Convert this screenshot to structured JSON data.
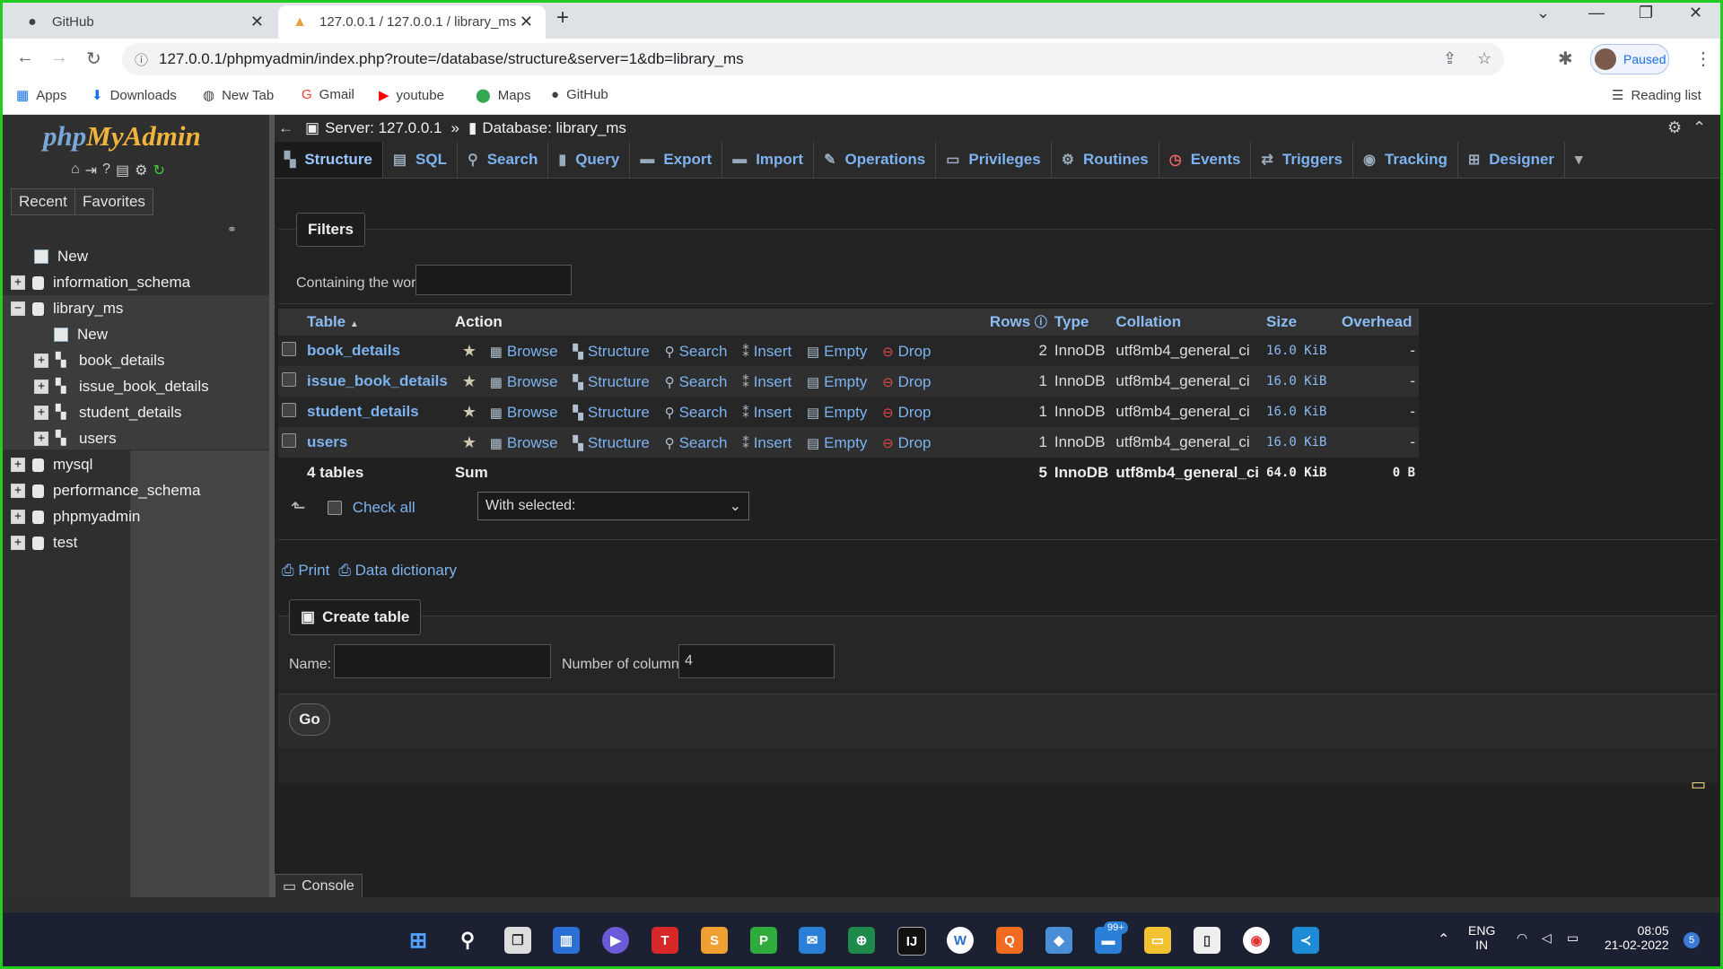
{
  "browser": {
    "tabs": [
      {
        "title": "GitHub",
        "icon": "github-icon"
      },
      {
        "title": "127.0.0.1 / 127.0.0.1 / library_ms",
        "icon": "phpmyadmin-icon"
      }
    ],
    "url": "127.0.0.1/phpmyadmin/index.php?route=/database/structure&server=1&db=library_ms",
    "profile_status": "Paused",
    "bookmarks": [
      "Apps",
      "Downloads",
      "New Tab",
      "Gmail",
      "youtube",
      "Maps",
      "GitHub"
    ],
    "reading_list": "Reading list"
  },
  "pma": {
    "logo_php": "php",
    "logo_myadmin": "MyAdmin",
    "sidebar": {
      "recent": "Recent",
      "favorites": "Favorites",
      "tree": [
        {
          "label": "New",
          "level": 0
        },
        {
          "label": "information_schema",
          "level": 0
        },
        {
          "label": "library_ms",
          "level": 0
        },
        {
          "label": "New",
          "level": 1
        },
        {
          "label": "book_details",
          "level": 1
        },
        {
          "label": "issue_book_details",
          "level": 1
        },
        {
          "label": "student_details",
          "level": 1
        },
        {
          "label": "users",
          "level": 1
        },
        {
          "label": "mysql",
          "level": 0
        },
        {
          "label": "performance_schema",
          "level": 0
        },
        {
          "label": "phpmyadmin",
          "level": 0
        },
        {
          "label": "test",
          "level": 0
        }
      ]
    },
    "breadcrumb": {
      "server": "Server: 127.0.0.1",
      "separator": "»",
      "database": "Database: library_ms"
    },
    "tabs": [
      "Structure",
      "SQL",
      "Search",
      "Query",
      "Export",
      "Import",
      "Operations",
      "Privileges",
      "Routines",
      "Events",
      "Triggers",
      "Tracking",
      "Designer"
    ],
    "filters": {
      "legend": "Filters",
      "label": "Containing the word:",
      "value": ""
    },
    "table_headers": {
      "table": "Table",
      "sort": "▲",
      "action": "Action",
      "rows": "Rows",
      "type": "Type",
      "collation": "Collation",
      "size": "Size",
      "overhead": "Overhead"
    },
    "actions": {
      "browse": "Browse",
      "structure": "Structure",
      "search": "Search",
      "insert": "Insert",
      "empty": "Empty",
      "drop": "Drop"
    },
    "rows": [
      {
        "name": "book_details",
        "rows": "2",
        "type": "InnoDB",
        "collation": "utf8mb4_general_ci",
        "size": "16.0 KiB",
        "overhead": "-"
      },
      {
        "name": "issue_book_details",
        "rows": "1",
        "type": "InnoDB",
        "collation": "utf8mb4_general_ci",
        "size": "16.0 KiB",
        "overhead": "-"
      },
      {
        "name": "student_details",
        "rows": "1",
        "type": "InnoDB",
        "collation": "utf8mb4_general_ci",
        "size": "16.0 KiB",
        "overhead": "-"
      },
      {
        "name": "users",
        "rows": "1",
        "type": "InnoDB",
        "collation": "utf8mb4_general_ci",
        "size": "16.0 KiB",
        "overhead": "-"
      }
    ],
    "summary": {
      "name": "4 tables",
      "action": "Sum",
      "rows": "5",
      "type": "InnoDB",
      "collation": "utf8mb4_general_ci",
      "size": "64.0 KiB",
      "overhead": "0 B"
    },
    "check_all": "Check all",
    "with_selected": "With selected:",
    "print": "Print",
    "data_dictionary": "Data dictionary",
    "create_table": {
      "legend": "Create table",
      "name_label": "Name:",
      "name_value": "",
      "columns_label": "Number of columns:",
      "columns_value": "4",
      "go": "Go"
    },
    "console": "Console"
  },
  "taskbar": {
    "badge": "99+",
    "lang_line1": "ENG",
    "lang_line2": "IN",
    "time": "08:05",
    "date": "21-02-2022",
    "notif": "5"
  }
}
